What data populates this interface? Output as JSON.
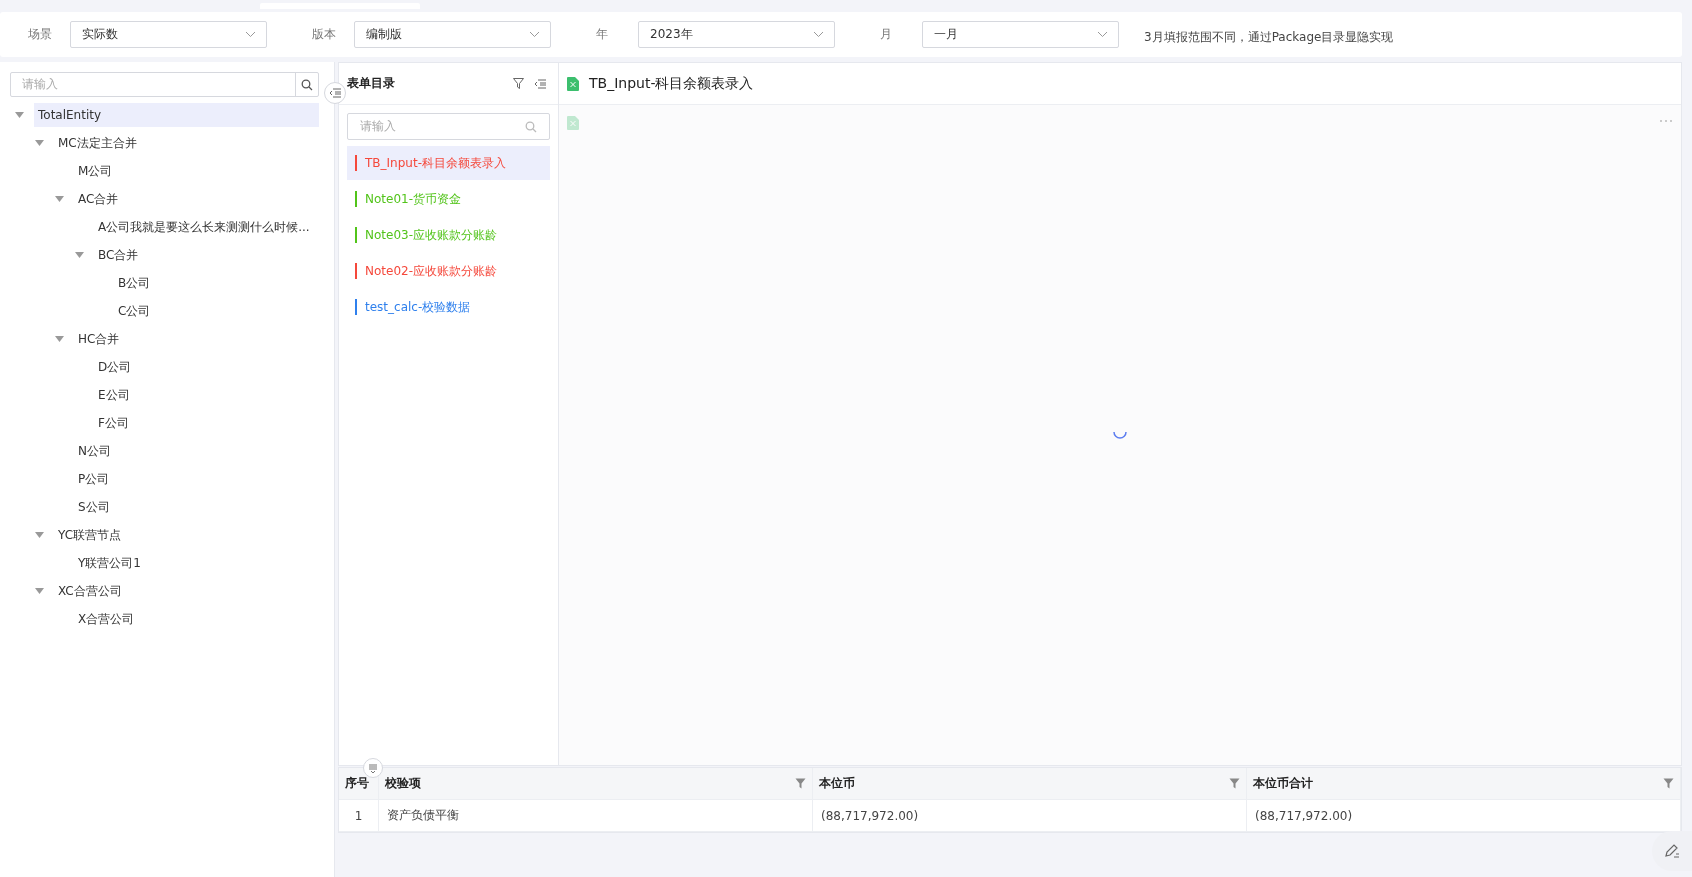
{
  "filters": [
    {
      "label": "场景",
      "value": "实际数"
    },
    {
      "label": "版本",
      "value": "编制版"
    },
    {
      "label": "年",
      "value": "2023年"
    },
    {
      "label": "月",
      "value": "一月"
    }
  ],
  "filter_note": "3月填报范围不同，通过Package目录显隐实现",
  "entity_tree": {
    "search": {
      "placeholder": "请输入"
    },
    "items": [
      {
        "label": "TotalEntity",
        "selected": true,
        "expanded": true,
        "children": [
          {
            "label": "MC法定主合并",
            "selected": false,
            "expanded": true,
            "children": [
              {
                "label": "M公司",
                "selected": false
              },
              {
                "label": "AC合并",
                "selected": false,
                "expanded": true,
                "children": [
                  {
                    "label": "A公司我就是要这么长来测测什么时候...",
                    "selected": false
                  },
                  {
                    "label": "BC合并",
                    "selected": false,
                    "expanded": true,
                    "children": [
                      {
                        "label": "B公司",
                        "selected": false
                      },
                      {
                        "label": "C公司",
                        "selected": false
                      }
                    ]
                  }
                ]
              },
              {
                "label": "HC合并",
                "selected": false,
                "expanded": true,
                "children": [
                  {
                    "label": "D公司",
                    "selected": false
                  },
                  {
                    "label": "E公司",
                    "selected": false
                  },
                  {
                    "label": "F公司",
                    "selected": false
                  }
                ]
              },
              {
                "label": "N公司",
                "selected": false
              },
              {
                "label": "P公司",
                "selected": false
              },
              {
                "label": "S公司",
                "selected": false
              }
            ]
          },
          {
            "label": "YC联营节点",
            "selected": false,
            "expanded": true,
            "children": [
              {
                "label": "Y联营公司1",
                "selected": false
              }
            ]
          },
          {
            "label": "XC合营公司",
            "selected": false,
            "expanded": true,
            "children": [
              {
                "label": "X合营公司",
                "selected": false
              }
            ]
          }
        ]
      }
    ]
  },
  "form_list": {
    "title": "表单目录",
    "search": {
      "placeholder": "请输入"
    },
    "items": [
      {
        "label": "TB_Input-科目余额表录入",
        "color": "#f5483b",
        "selected": true
      },
      {
        "label": "Note01-货币资金",
        "color": "#52c41a",
        "selected": false
      },
      {
        "label": "Note03-应收账款分账龄",
        "color": "#52c41a",
        "selected": false
      },
      {
        "label": "Note02-应收账款分账龄",
        "color": "#f5483b",
        "selected": false
      },
      {
        "label": "test_calc-校验数据",
        "color": "#2f80ed",
        "selected": false
      }
    ]
  },
  "form_view": {
    "title": "TB_Input-科目余额表录入"
  },
  "check_table": {
    "columns": [
      {
        "label": "序号",
        "filter": false
      },
      {
        "label": "校验项",
        "filter": true
      },
      {
        "label": "本位币",
        "filter": true
      },
      {
        "label": "本位币合计",
        "filter": true
      }
    ],
    "rows": [
      [
        "1",
        "资产负债平衡",
        "(88,717,972.00)",
        "(88,717,972.00)"
      ]
    ]
  }
}
